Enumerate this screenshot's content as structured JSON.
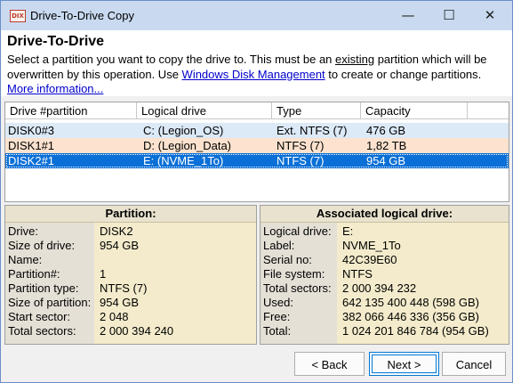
{
  "window": {
    "app_icon_text": "DIX",
    "title": "Drive-To-Drive Copy",
    "minimize_glyph": "—",
    "maximize_glyph": "☐",
    "close_glyph": "✕"
  },
  "header": {
    "title": "Drive-To-Drive",
    "desc_part1": "Select a partition you want to copy the drive to. This must be an ",
    "desc_emph": "existing",
    "desc_part2": " partition which will be overwritten by this operation. Use ",
    "link_disk_mgmt": "Windows Disk Management",
    "desc_part3": " to create or change partitions. ",
    "link_more": "More information..."
  },
  "table": {
    "columns": [
      "Drive #partition",
      "Logical drive",
      "Type",
      "Capacity"
    ],
    "rows": [
      [
        "DISK0#3",
        "C: (Legion_OS)",
        "Ext. NTFS (7)",
        "476 GB"
      ],
      [
        "DISK1#1",
        "D: (Legion_Data)",
        "NTFS (7)",
        "1,82 TB"
      ],
      [
        "DISK2#1",
        "E: (NVME_1To)",
        "NTFS (7)",
        "954 GB"
      ]
    ],
    "selected_row": 2
  },
  "partition_panel": {
    "title": "Partition:",
    "fields": [
      {
        "label": "Drive:",
        "value": "DISK2"
      },
      {
        "label": "Size of drive:",
        "value": "954 GB"
      },
      {
        "label": "Name:",
        "value": ""
      },
      {
        "label": "Partition#:",
        "value": "1"
      },
      {
        "label": "Partition type:",
        "value": "NTFS (7)"
      },
      {
        "label": "Size of partition:",
        "value": "954 GB"
      },
      {
        "label": "Start sector:",
        "value": "2 048"
      },
      {
        "label": "Total sectors:",
        "value": "2 000 394 240"
      }
    ]
  },
  "logical_panel": {
    "title": "Associated logical drive:",
    "fields": [
      {
        "label": "Logical drive:",
        "value": "E:"
      },
      {
        "label": "Label:",
        "value": "NVME_1To"
      },
      {
        "label": "Serial no:",
        "value": "42C39E60"
      },
      {
        "label": "File system:",
        "value": "NTFS"
      },
      {
        "label": "Total sectors:",
        "value": "2 000 394 232"
      },
      {
        "label": "Used:",
        "value": "642 135 400 448 (598 GB)"
      },
      {
        "label": "Free:",
        "value": "382 066 446 336 (356 GB)"
      },
      {
        "label": "Total:",
        "value": "1 024 201 846 784 (954 GB)"
      }
    ]
  },
  "buttons": {
    "back": "< Back",
    "next": "Next >",
    "cancel": "Cancel"
  }
}
